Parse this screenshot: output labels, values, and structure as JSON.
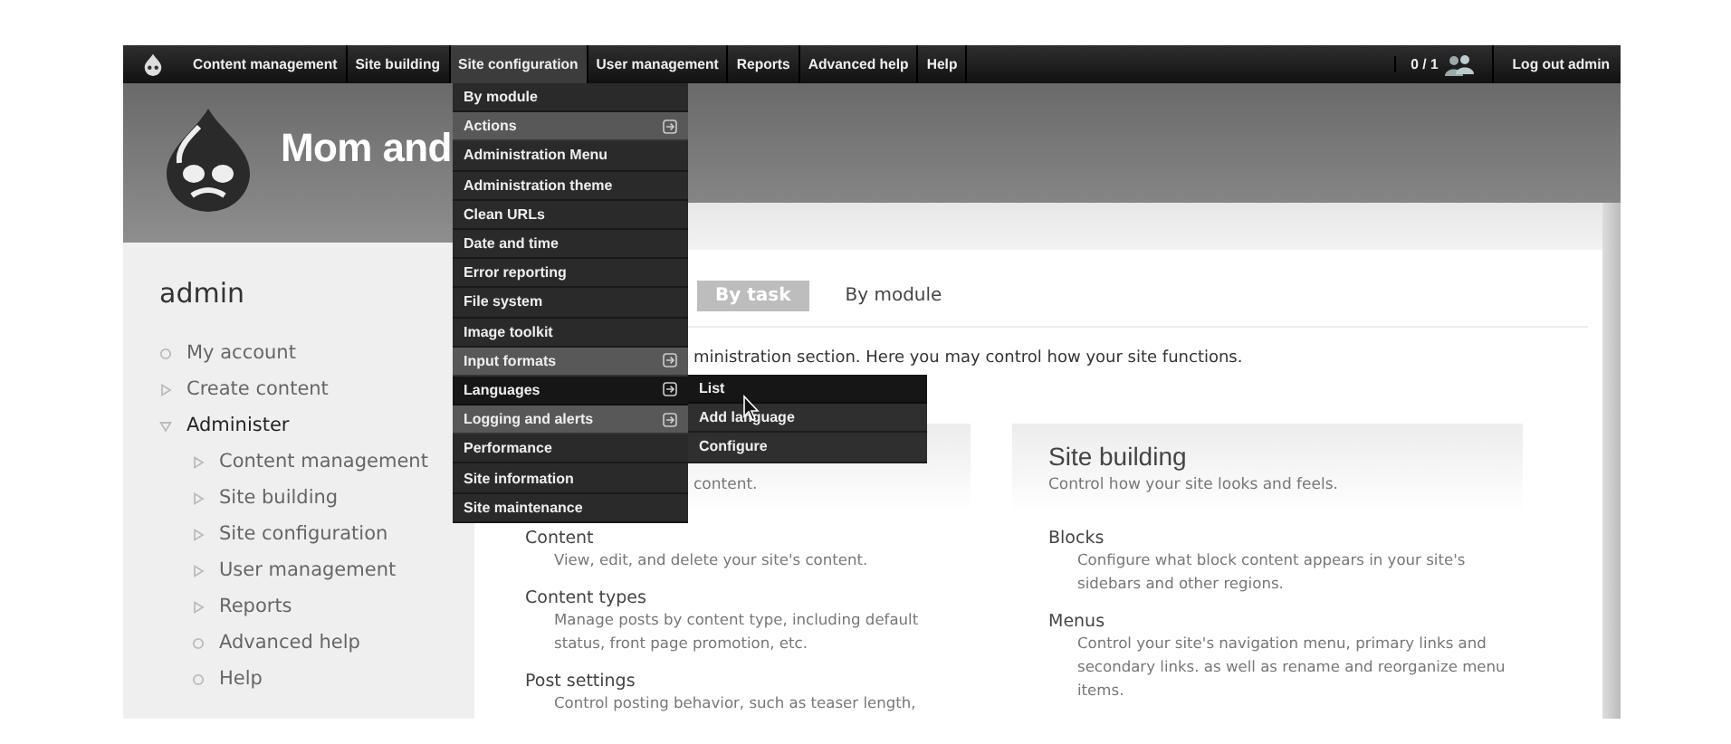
{
  "toolbar": {
    "items": [
      {
        "label": "Content management",
        "selected": false
      },
      {
        "label": "Site building",
        "selected": false
      },
      {
        "label": "Site configuration",
        "selected": true
      },
      {
        "label": "User management",
        "selected": false
      },
      {
        "label": "Reports",
        "selected": false
      },
      {
        "label": "Advanced help",
        "selected": false
      },
      {
        "label": "Help",
        "selected": false
      }
    ],
    "counter": "0 / 1",
    "logout": "Log out admin"
  },
  "header": {
    "site_name": "Mom and"
  },
  "sidebar": {
    "title": "admin",
    "items": [
      {
        "label": "My account",
        "kind": "leaf",
        "selected": false
      },
      {
        "label": "Create content",
        "kind": "collapsed",
        "selected": false
      },
      {
        "label": "Administer",
        "kind": "expanded",
        "selected": true,
        "children": [
          {
            "label": "Content management",
            "kind": "collapsed",
            "selected": false
          },
          {
            "label": "Site building",
            "kind": "collapsed",
            "selected": false
          },
          {
            "label": "Site configuration",
            "kind": "collapsed",
            "selected": false
          },
          {
            "label": "User management",
            "kind": "collapsed",
            "selected": false
          },
          {
            "label": "Reports",
            "kind": "collapsed",
            "selected": false
          },
          {
            "label": "Advanced help",
            "kind": "leaf",
            "selected": false
          },
          {
            "label": "Help",
            "kind": "leaf",
            "selected": false
          }
        ]
      }
    ]
  },
  "content": {
    "tabs": [
      {
        "label": "By task",
        "selected": true
      },
      {
        "label": "By module",
        "selected": false
      }
    ],
    "intro": "ministration section. Here you may control how your site functions.",
    "panels": [
      {
        "description": "content.",
        "entries": [
          {
            "title": "Content",
            "description": "View, edit, and delete your site's content."
          },
          {
            "title": "Content types",
            "description": "Manage posts by content type, including default status, front page promotion, etc."
          },
          {
            "title": "Post settings",
            "description": "Control posting behavior, such as teaser length,"
          }
        ]
      },
      {
        "title": "Site building",
        "description": "Control how your site looks and feels.",
        "entries": [
          {
            "title": "Blocks",
            "description": "Configure what block content appears in your site's sidebars and other regions."
          },
          {
            "title": "Menus",
            "description": "Control your site's navigation menu, primary links and secondary links. as well as rename and reorganize menu items."
          }
        ]
      }
    ]
  },
  "dropdown": {
    "items": [
      {
        "label": "By module",
        "has_submenu": false,
        "selected": false
      },
      {
        "label": "Actions",
        "has_submenu": true,
        "selected": false
      },
      {
        "label": "Administration Menu",
        "has_submenu": false,
        "selected": false
      },
      {
        "label": "Administration theme",
        "has_submenu": false,
        "selected": false
      },
      {
        "label": "Clean URLs",
        "has_submenu": false,
        "selected": false
      },
      {
        "label": "Date and time",
        "has_submenu": false,
        "selected": false
      },
      {
        "label": "Error reporting",
        "has_submenu": false,
        "selected": false
      },
      {
        "label": "File system",
        "has_submenu": false,
        "selected": false
      },
      {
        "label": "Image toolkit",
        "has_submenu": false,
        "selected": false
      },
      {
        "label": "Input formats",
        "has_submenu": true,
        "selected": false
      },
      {
        "label": "Languages",
        "has_submenu": true,
        "selected": true
      },
      {
        "label": "Logging and alerts",
        "has_submenu": true,
        "selected": false
      },
      {
        "label": "Performance",
        "has_submenu": false,
        "selected": false
      },
      {
        "label": "Site information",
        "has_submenu": false,
        "selected": false
      },
      {
        "label": "Site maintenance",
        "has_submenu": false,
        "selected": false
      }
    ]
  },
  "submenu": {
    "items": [
      {
        "label": "List",
        "selected": true
      },
      {
        "label": "Add language",
        "selected": false
      },
      {
        "label": "Configure",
        "selected": false
      }
    ]
  }
}
